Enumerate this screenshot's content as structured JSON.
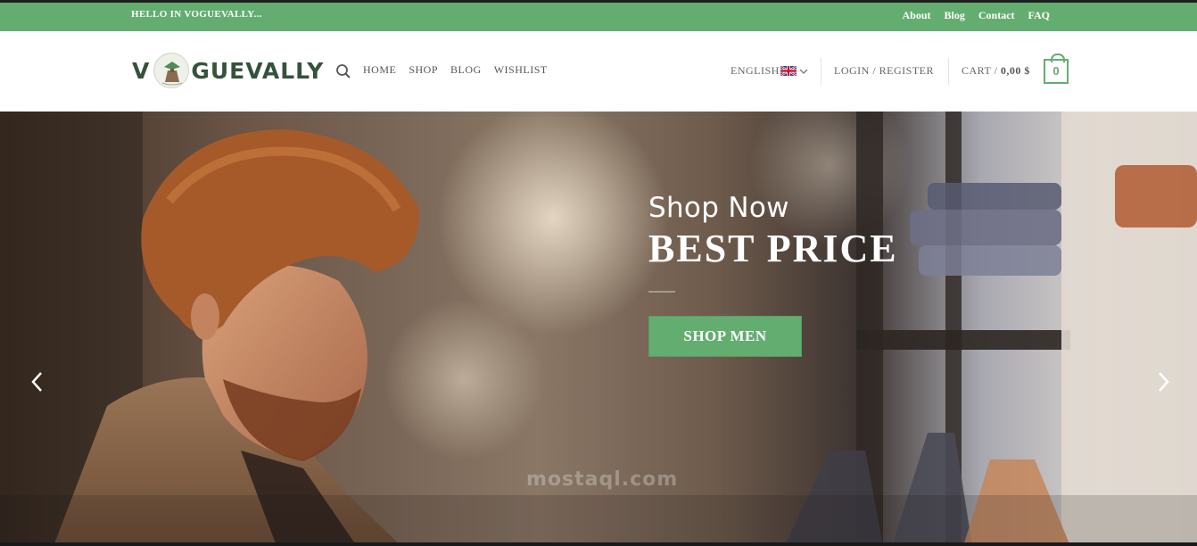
{
  "topbar": {
    "greeting": "HELLO IN VOGUEVALLY...",
    "links": [
      "About",
      "Blog",
      "Contact",
      "FAQ"
    ],
    "bg_color": "#64ad70"
  },
  "header": {
    "logo": {
      "left_text": "V",
      "right_text": "GUEVALLY"
    },
    "nav": [
      "HOME",
      "SHOP",
      "BLOG",
      "WISHLIST"
    ],
    "language": {
      "label": "ENGLISH",
      "flag": "uk-flag-icon"
    },
    "login_label": "LOGIN / REGISTER",
    "cart": {
      "label": "CART /",
      "amount": "0,00 $",
      "count": "0"
    },
    "accent_color": "#64ad70"
  },
  "hero": {
    "subtitle": "Shop Now",
    "title": "BEST PRICE",
    "button_label": "SHOP MEN",
    "watermark": "mostaql.com",
    "prev_icon": "chevron-left-icon",
    "next_icon": "chevron-right-icon"
  }
}
